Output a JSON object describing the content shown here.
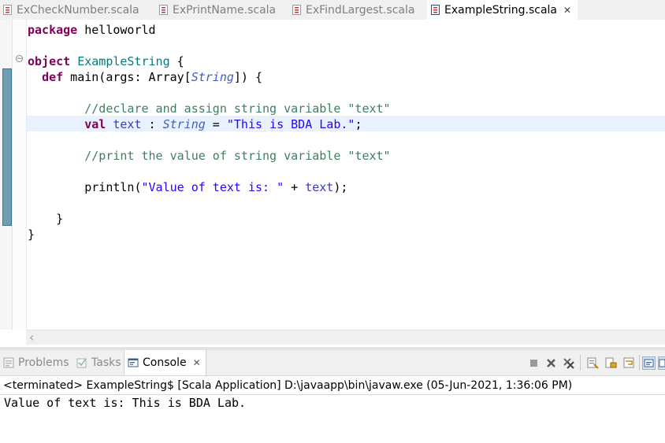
{
  "editor_tabs": [
    {
      "label": "ExCheckNumber.scala",
      "active": false
    },
    {
      "label": "ExPrintName.scala",
      "active": false
    },
    {
      "label": "ExFindLargest.scala",
      "active": false
    },
    {
      "label": "ExampleString.scala",
      "active": true
    }
  ],
  "code": {
    "l1": {
      "kw": "package",
      "rest": " helloworld"
    },
    "l3": {
      "kw": "object",
      "name": "ExampleString",
      "rest": " {"
    },
    "l4": {
      "indent": "  ",
      "kw": "def",
      "a": " main(args: Array[",
      "type": "String",
      "b": "]) {"
    },
    "l6": {
      "indent": "        ",
      "comment": "//declare and assign string variable \"text\""
    },
    "l7": {
      "indent": "        ",
      "kw": "val",
      "var": "text",
      "colon": " : ",
      "type": "String",
      "eq": " = ",
      "str": "\"This is BDA Lab.\"",
      "end": ";"
    },
    "l9": {
      "indent": "        ",
      "comment": "//print the value of string variable \"text\""
    },
    "l11": {
      "indent": "        ",
      "call": "println(",
      "str": "\"Value of text is: \"",
      "plus": " + ",
      "var": "text",
      "end": ");"
    },
    "l13": "    }",
    "l14": "}"
  },
  "view_tabs": [
    {
      "label": "Problems",
      "icon": "problems-icon",
      "active": false
    },
    {
      "label": "Tasks",
      "icon": "tasks-icon",
      "active": false
    },
    {
      "label": "Console",
      "icon": "console-icon",
      "active": true
    }
  ],
  "console": {
    "description": "<terminated> ExampleString$ [Scala Application] D:\\javaapp\\bin\\javaw.exe (05-Jun-2021, 1:36:06 PM)",
    "output": "Value of text is: This is BDA Lab."
  },
  "toolbar_icons": [
    "terminate-icon",
    "remove-launch-icon",
    "remove-all-terminated-icon",
    "clear-console-icon",
    "scroll-lock-icon",
    "word-wrap-icon",
    "pin-console-icon",
    "display-console-icon"
  ],
  "colors": {
    "keyword": "#7f0055",
    "comment": "#3f7f5f",
    "string": "#2a00ff",
    "type": "#3f5fbf",
    "current_line": "#e8f2fe"
  }
}
